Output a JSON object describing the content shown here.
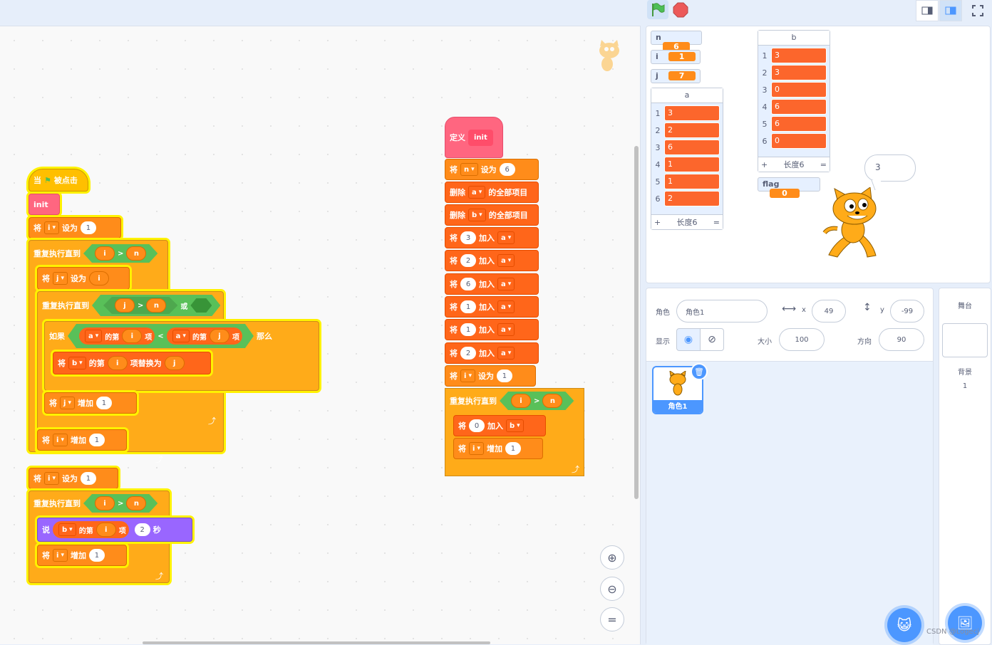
{
  "topbar": {
    "green_flag_icon": "green-flag-icon",
    "stop_icon": "stop-icon",
    "layout_small": "small-stage-icon",
    "layout_normal": "normal-stage-icon",
    "fullscreen": "fullscreen-icon"
  },
  "script1": {
    "hat_when": "当",
    "hat_clicked": "被点击",
    "init": "init",
    "set1_prefix": "将",
    "set1_var": "i",
    "set1_word": "设为",
    "set1_val": "1",
    "repeat_until": "重复执行直到",
    "cond_i": "i",
    "gt": ">",
    "cond_n": "n",
    "set_j_prefix": "将",
    "set_j_var": "j",
    "set_j_word": "设为",
    "set_j_val": "i",
    "inner_repeat": "重复执行直到",
    "ij": "j",
    "in": "n",
    "or": "或",
    "if_word": "如果",
    "list_a1": "a",
    "the": "的第",
    "idx_i": "i",
    "item": "项",
    "lt": "<",
    "list_a2": "a",
    "the2": "的第",
    "idx_j": "j",
    "item2": "项",
    "then": "那么",
    "replace_prefix": "将",
    "replace_list": "b",
    "replace_the": "的第",
    "replace_i": "i",
    "replace_word": "项替换为",
    "replace_val": "j",
    "inc_j_prefix": "将",
    "inc_j_var": "j",
    "inc_j_word": "增加",
    "inc_j_val": "1",
    "inc_i_prefix": "将",
    "inc_i_var": "i",
    "inc_i_word": "增加",
    "inc_i_val": "1",
    "set2_prefix": "将",
    "set2_var": "i",
    "set2_word": "设为",
    "set2_val": "1",
    "repeat2": "重复执行直到",
    "r2_i": "i",
    "r2_gt": ">",
    "r2_n": "n",
    "say": "说",
    "say_list": "b",
    "say_the": "的第",
    "say_i": "i",
    "say_item": "项",
    "say_secs": "2",
    "say_sec_word": "秒",
    "inc2_prefix": "将",
    "inc2_var": "i",
    "inc2_word": "增加",
    "inc2_val": "1"
  },
  "script2": {
    "define": "定义",
    "define_name": "init",
    "s1": {
      "a": "将",
      "b": "n",
      "c": "设为",
      "d": "6"
    },
    "del_a": {
      "a": "删除",
      "b": "a",
      "c": "的全部项目"
    },
    "del_b": {
      "a": "删除",
      "b": "b",
      "c": "的全部项目"
    },
    "add1": {
      "a": "将",
      "b": "3",
      "c": "加入",
      "d": "a"
    },
    "add2": {
      "a": "将",
      "b": "2",
      "c": "加入",
      "d": "a"
    },
    "add3": {
      "a": "将",
      "b": "6",
      "c": "加入",
      "d": "a"
    },
    "add4": {
      "a": "将",
      "b": "1",
      "c": "加入",
      "d": "a"
    },
    "add5": {
      "a": "将",
      "b": "1",
      "c": "加入",
      "d": "a"
    },
    "add6": {
      "a": "将",
      "b": "2",
      "c": "加入",
      "d": "a"
    },
    "seti": {
      "a": "将",
      "b": "i",
      "c": "设为",
      "d": "1"
    },
    "rep": {
      "a": "重复执行直到",
      "b": "i",
      "c": ">",
      "d": "n"
    },
    "addb": {
      "a": "将",
      "b": "0",
      "c": "加入",
      "d": "b"
    },
    "inci": {
      "a": "将",
      "b": "i",
      "c": "增加",
      "d": "1"
    }
  },
  "stage": {
    "monitors": [
      {
        "name": "n",
        "value": "6"
      },
      {
        "name": "i",
        "value": "1"
      },
      {
        "name": "j",
        "value": "7"
      }
    ],
    "flag": {
      "name": "flag",
      "value": "0"
    },
    "list_a": {
      "name": "a",
      "items": [
        "3",
        "2",
        "6",
        "1",
        "1",
        "2"
      ],
      "length": "长度6",
      "plus": "+",
      "eq": "="
    },
    "list_b": {
      "name": "b",
      "items": [
        "3",
        "3",
        "0",
        "6",
        "6",
        "0"
      ],
      "length": "长度6",
      "plus": "+",
      "eq": "="
    },
    "say_bubble": "3"
  },
  "sprite_info": {
    "sprite_label": "角色",
    "sprite_name": "角色1",
    "x_label": "x",
    "x": "49",
    "y_label": "y",
    "y": "-99",
    "show_label": "显示",
    "size_label": "大小",
    "size": "100",
    "direction_label": "方向",
    "direction": "90",
    "thumb_name": "角色1"
  },
  "stage_pane": {
    "title": "舞台",
    "backdrop_label": "背景",
    "backdrop_count": "1"
  },
  "watermark": "CSDN @Logecj",
  "colors": {
    "motion_var": "#ff8c1a",
    "control": "#ffab19",
    "event": "#ffbf00",
    "list": "#ff661a",
    "operator": "#59c059",
    "myblock": "#ff6680",
    "looks": "#9966ff",
    "highlight": "#fff200"
  }
}
